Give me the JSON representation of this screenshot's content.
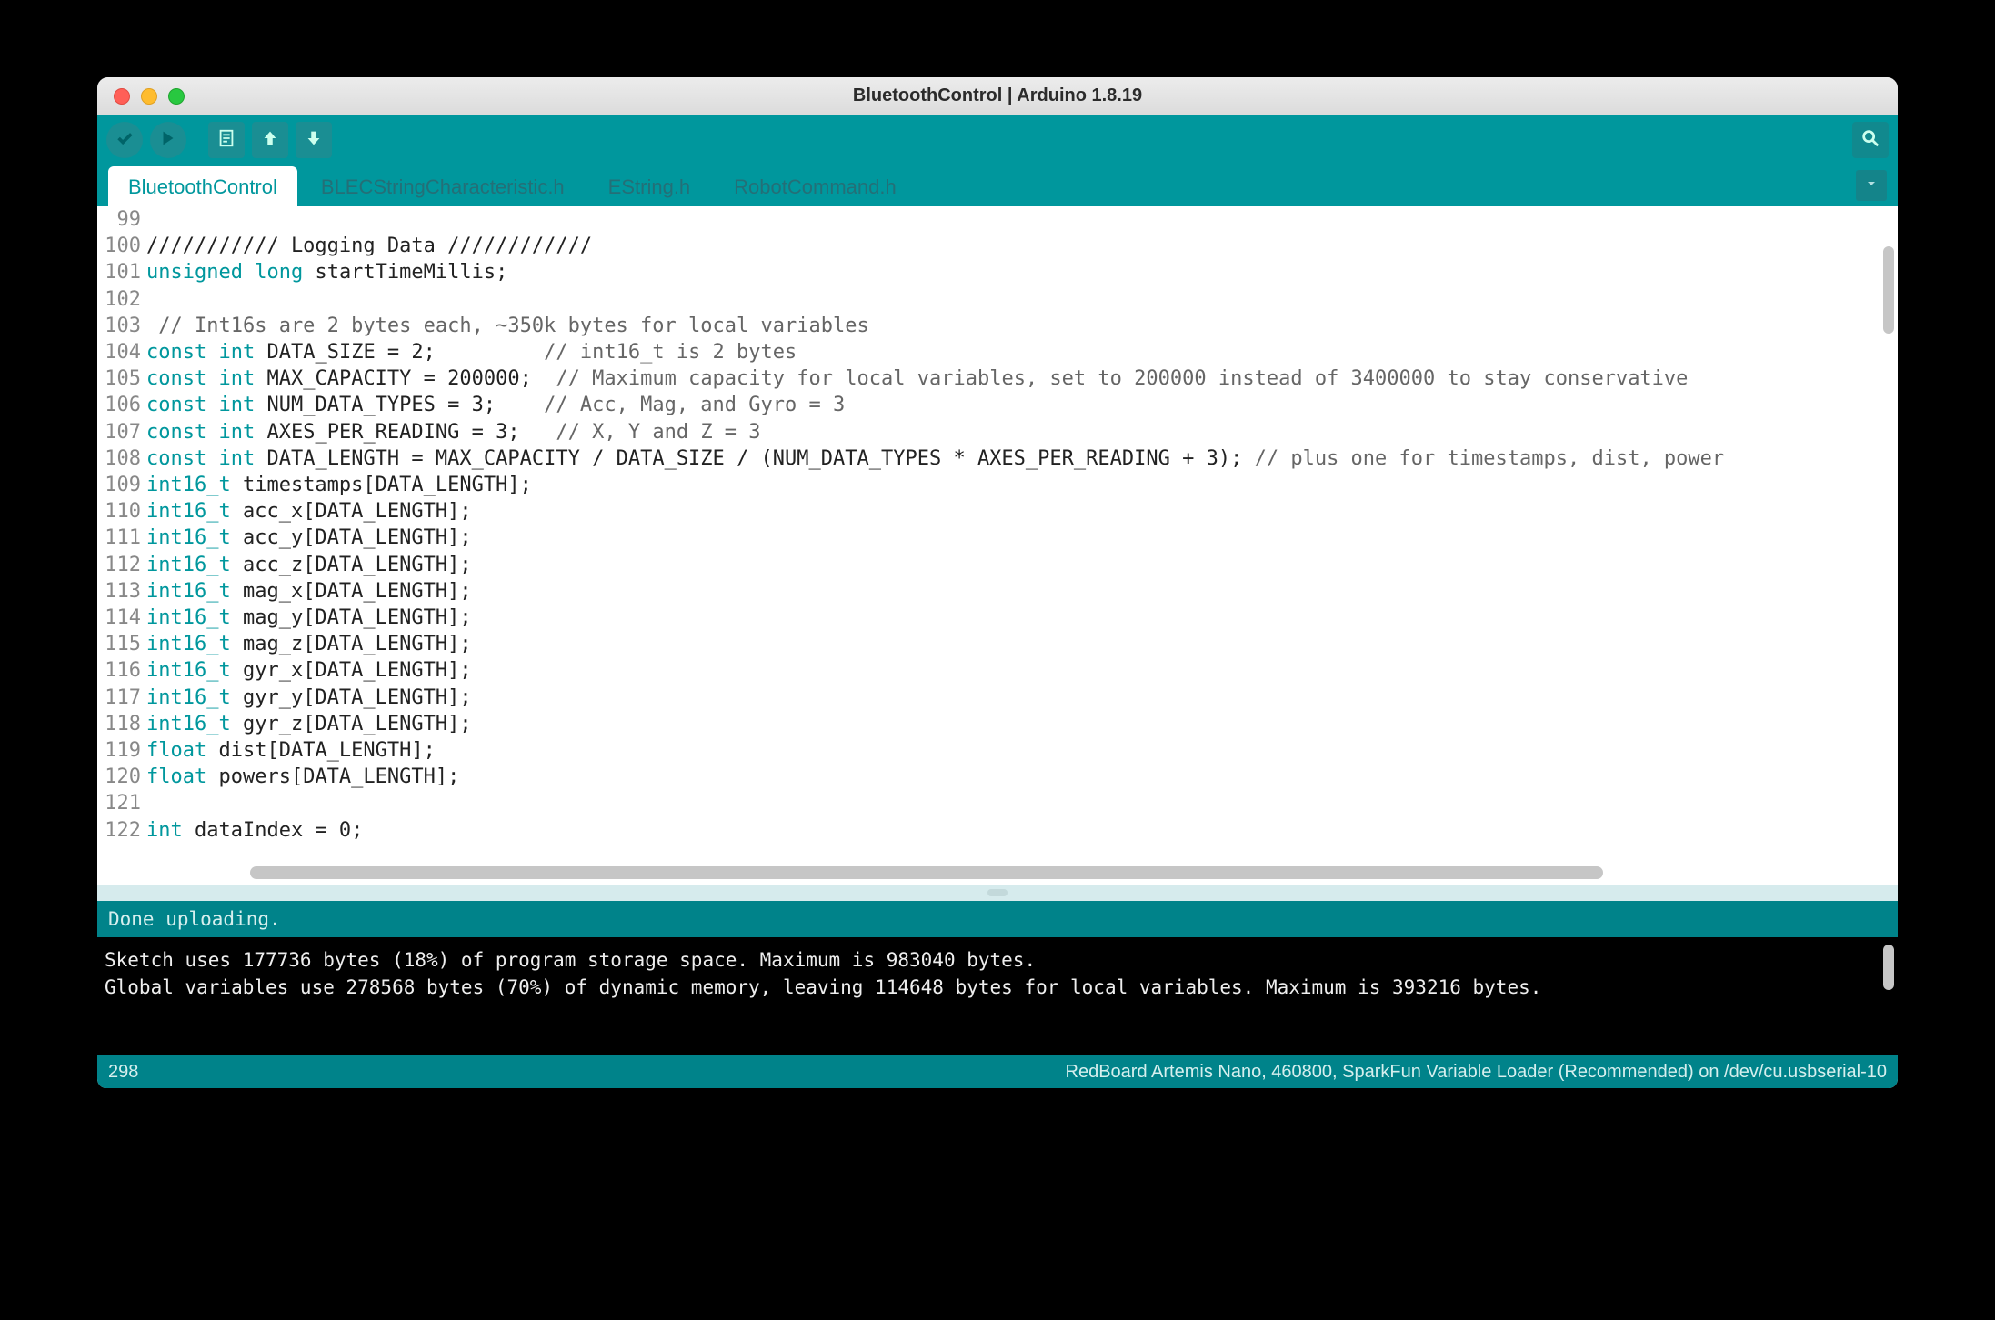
{
  "window": {
    "title": "BluetoothControl | Arduino 1.8.19"
  },
  "tabs": [
    {
      "label": "BluetoothControl",
      "active": true
    },
    {
      "label": "BLECStringCharacteristic.h",
      "active": false
    },
    {
      "label": "EString.h",
      "active": false
    },
    {
      "label": "RobotCommand.h",
      "active": false
    }
  ],
  "code_lines": [
    {
      "n": 99,
      "tokens": []
    },
    {
      "n": 100,
      "tokens": [
        {
          "t": "/////////// Logging Data ////////////",
          "c": "code"
        }
      ]
    },
    {
      "n": 101,
      "tokens": [
        {
          "t": "unsigned",
          "c": "kw"
        },
        {
          "t": " ",
          "c": "code"
        },
        {
          "t": "long",
          "c": "kw"
        },
        {
          "t": " startTimeMillis;",
          "c": "code"
        }
      ]
    },
    {
      "n": 102,
      "tokens": []
    },
    {
      "n": 103,
      "tokens": [
        {
          "t": " // Int16s are 2 bytes each, ~350k bytes for local variables",
          "c": "cm"
        }
      ]
    },
    {
      "n": 104,
      "tokens": [
        {
          "t": "const",
          "c": "kw"
        },
        {
          "t": " ",
          "c": "code"
        },
        {
          "t": "int",
          "c": "kw"
        },
        {
          "t": " DATA_SIZE = 2;         ",
          "c": "code"
        },
        {
          "t": "// int16_t is 2 bytes",
          "c": "cm"
        }
      ]
    },
    {
      "n": 105,
      "tokens": [
        {
          "t": "const",
          "c": "kw"
        },
        {
          "t": " ",
          "c": "code"
        },
        {
          "t": "int",
          "c": "kw"
        },
        {
          "t": " MAX_CAPACITY = 200000;  ",
          "c": "code"
        },
        {
          "t": "// Maximum capacity for local variables, set to 200000 instead of 3400000 to stay conservative",
          "c": "cm"
        }
      ]
    },
    {
      "n": 106,
      "tokens": [
        {
          "t": "const",
          "c": "kw"
        },
        {
          "t": " ",
          "c": "code"
        },
        {
          "t": "int",
          "c": "kw"
        },
        {
          "t": " NUM_DATA_TYPES = 3;    ",
          "c": "code"
        },
        {
          "t": "// Acc, Mag, and Gyro = 3",
          "c": "cm"
        }
      ]
    },
    {
      "n": 107,
      "tokens": [
        {
          "t": "const",
          "c": "kw"
        },
        {
          "t": " ",
          "c": "code"
        },
        {
          "t": "int",
          "c": "kw"
        },
        {
          "t": " AXES_PER_READING = 3;   ",
          "c": "code"
        },
        {
          "t": "// X, Y and Z = 3",
          "c": "cm"
        }
      ]
    },
    {
      "n": 108,
      "tokens": [
        {
          "t": "const",
          "c": "kw"
        },
        {
          "t": " ",
          "c": "code"
        },
        {
          "t": "int",
          "c": "kw"
        },
        {
          "t": " DATA_LENGTH = MAX_CAPACITY / DATA_SIZE / (NUM_DATA_TYPES * AXES_PER_READING + 3); ",
          "c": "code"
        },
        {
          "t": "// plus one for timestamps, dist, power",
          "c": "cm"
        }
      ]
    },
    {
      "n": 109,
      "tokens": [
        {
          "t": "int16_t",
          "c": "kw"
        },
        {
          "t": " timestamps[DATA_LENGTH];",
          "c": "code"
        }
      ]
    },
    {
      "n": 110,
      "tokens": [
        {
          "t": "int16_t",
          "c": "kw"
        },
        {
          "t": " acc_x[DATA_LENGTH];",
          "c": "code"
        }
      ]
    },
    {
      "n": 111,
      "tokens": [
        {
          "t": "int16_t",
          "c": "kw"
        },
        {
          "t": " acc_y[DATA_LENGTH];",
          "c": "code"
        }
      ]
    },
    {
      "n": 112,
      "tokens": [
        {
          "t": "int16_t",
          "c": "kw"
        },
        {
          "t": " acc_z[DATA_LENGTH];",
          "c": "code"
        }
      ]
    },
    {
      "n": 113,
      "tokens": [
        {
          "t": "int16_t",
          "c": "kw"
        },
        {
          "t": " mag_x[DATA_LENGTH];",
          "c": "code"
        }
      ]
    },
    {
      "n": 114,
      "tokens": [
        {
          "t": "int16_t",
          "c": "kw"
        },
        {
          "t": " mag_y[DATA_LENGTH];",
          "c": "code"
        }
      ]
    },
    {
      "n": 115,
      "tokens": [
        {
          "t": "int16_t",
          "c": "kw"
        },
        {
          "t": " mag_z[DATA_LENGTH];",
          "c": "code"
        }
      ]
    },
    {
      "n": 116,
      "tokens": [
        {
          "t": "int16_t",
          "c": "kw"
        },
        {
          "t": " gyr_x[DATA_LENGTH];",
          "c": "code"
        }
      ]
    },
    {
      "n": 117,
      "tokens": [
        {
          "t": "int16_t",
          "c": "kw"
        },
        {
          "t": " gyr_y[DATA_LENGTH];",
          "c": "code"
        }
      ]
    },
    {
      "n": 118,
      "tokens": [
        {
          "t": "int16_t",
          "c": "kw"
        },
        {
          "t": " gyr_z[DATA_LENGTH];",
          "c": "code"
        }
      ]
    },
    {
      "n": 119,
      "tokens": [
        {
          "t": "float",
          "c": "kw"
        },
        {
          "t": " dist[DATA_LENGTH];",
          "c": "code"
        }
      ]
    },
    {
      "n": 120,
      "tokens": [
        {
          "t": "float",
          "c": "kw"
        },
        {
          "t": " powers[DATA_LENGTH];",
          "c": "code"
        }
      ]
    },
    {
      "n": 121,
      "tokens": []
    },
    {
      "n": 122,
      "tokens": [
        {
          "t": "int",
          "c": "kw"
        },
        {
          "t": " dataIndex = 0;",
          "c": "code"
        }
      ]
    }
  ],
  "status": {
    "message": "Done uploading."
  },
  "console_lines": [
    "Sketch uses 177736 bytes (18%) of program storage space. Maximum is 983040 bytes.",
    "Global variables use 278568 bytes (70%) of dynamic memory, leaving 114648 bytes for local variables. Maximum is 393216 bytes."
  ],
  "footer": {
    "line_number": "298",
    "board_info": "RedBoard Artemis Nano, 460800, SparkFun Variable Loader (Recommended) on /dev/cu.usbserial-10"
  }
}
